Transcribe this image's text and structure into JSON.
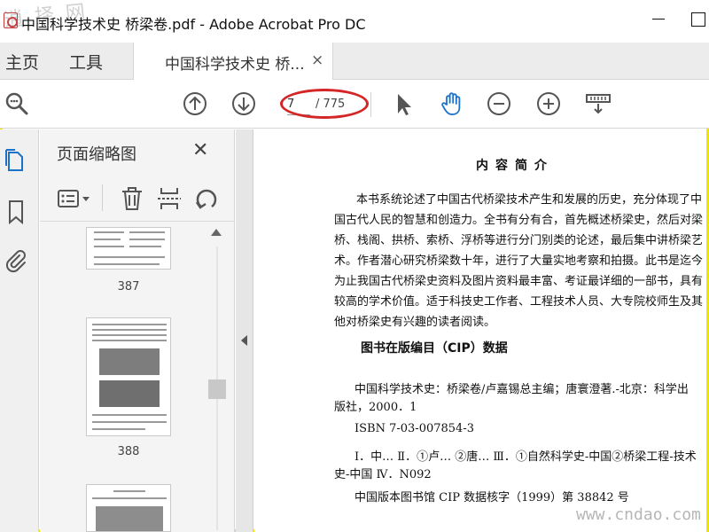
{
  "window": {
    "title": "中国科学技术史 桥梁卷.pdf - Adobe Acrobat Pro DC",
    "watermark_top": "逍 择 网"
  },
  "tabs": {
    "home": "主页",
    "tools": "工具",
    "document": "中国科学技术史 桥...",
    "document_close": "×"
  },
  "toolbar": {
    "current_page": "7",
    "total_pages": "/ 775",
    "icons": [
      "search-icon",
      "page-up-icon",
      "page-down-icon",
      "select-arrow-icon",
      "hand-icon",
      "zoom-out-icon",
      "zoom-in-icon",
      "more-tools-icon"
    ],
    "accent_color": "#1a73c9",
    "annotation_color": "#d42626"
  },
  "rail": {
    "icons": [
      "page-thumbnails-icon",
      "bookmark-icon",
      "attachment-icon"
    ]
  },
  "thumbnails_panel": {
    "title": "页面缩略图",
    "close": "✕",
    "pages": [
      {
        "number": "387"
      },
      {
        "number": "388"
      },
      {
        "number": ""
      }
    ]
  },
  "document": {
    "heading": "内容简介",
    "intro_lines": [
      "本书系统论述了中国古代桥梁技术产生和发展的历史，充分体现了中",
      "国古代人民的智慧和创造力。全书有分有合，首先概述桥梁史，然后对梁",
      "桥、栈阁、拱桥、索桥、浮桥等进行分门别类的论述，最后集中讲桥梁艺",
      "术。作者潜心研究桥梁数十年，进行了大量实地考察和拍摄。此书是迄今",
      "为止我国古代桥梁史资料及图片资料最丰富、考证最详细的一部书，具有",
      "较高的学术价值。适于科技史工作者、工程技术人员、大专院校师生及其",
      "他对桥梁史有兴趣的读者阅读。"
    ],
    "cip_heading": "图书在版编目（CIP）数据",
    "cip_lines": [
      "中国科学技术史：桥梁卷/卢嘉锡总主编；唐寰澄著.-北京：科学出",
      "版社，2000．1"
    ],
    "isbn": "ISBN 7-03-007854-3",
    "classification_lines": [
      "Ⅰ．中… Ⅱ．①卢… ②唐… Ⅲ．①自然科学史-中国②桥梁工程-技术",
      "史-中国 Ⅳ．N092"
    ],
    "cip_number": "中国版本图书馆 CIP 数据核字（1999）第 38842 号"
  },
  "watermark_bottom": "www.cndao.com"
}
